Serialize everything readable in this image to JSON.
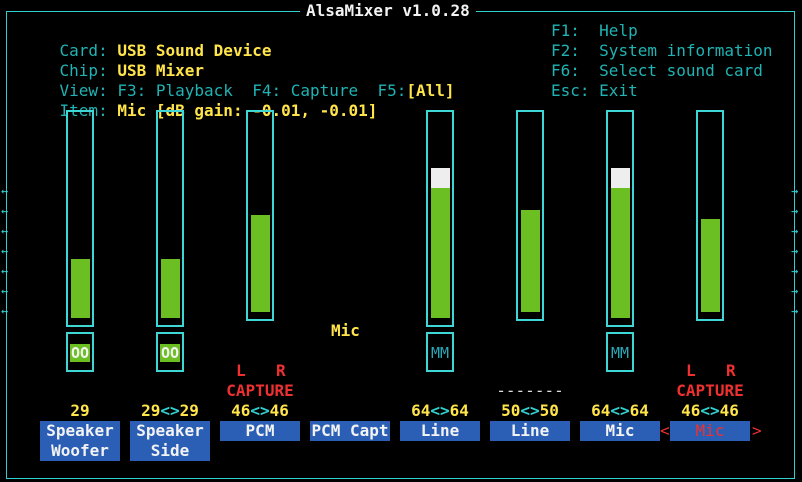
{
  "app": {
    "title": "AlsaMixer v1.0.28"
  },
  "info": {
    "card_label": "Card:",
    "card_value": "USB Sound Device",
    "chip_label": "Chip:",
    "chip_value": "USB Mixer",
    "view_label": "View:",
    "view_playback": "F3: Playback",
    "view_capture": "F4: Capture",
    "view_f5": "F5:",
    "view_all": "[All]",
    "item_label": "Item:",
    "item_value": "Mic [dB gain: -0.01, -0.01]"
  },
  "keys": [
    {
      "key": "F1:",
      "action": "Help"
    },
    {
      "key": "F2:",
      "action": "System information"
    },
    {
      "key": "F6:",
      "action": "Select sound card"
    },
    {
      "key": "Esc:",
      "action": "Exit"
    }
  ],
  "focus_label": "Mic",
  "channels": [
    {
      "name_line1": "Speaker",
      "name_line2": "Woofer",
      "level": 0.29,
      "volume_left": "29",
      "volume_right": "",
      "switch": "OO",
      "capture_l": "",
      "capture_r": "",
      "capture_text": ""
    },
    {
      "name_line1": "Speaker",
      "name_line2": "Side",
      "level": 0.29,
      "volume_left": "29",
      "volume_right": "29",
      "switch": "OO",
      "capture_l": "",
      "capture_r": "",
      "capture_text": ""
    },
    {
      "name_line1": "PCM",
      "name_line2": "",
      "level": 0.48,
      "volume_left": "46",
      "volume_right": "46",
      "switch": "",
      "capture_l": "L",
      "capture_r": "R",
      "capture_text": "CAPTURE"
    },
    {
      "name_line1": "PCM Capt",
      "name_line2": "",
      "level": null,
      "volume_left": "",
      "volume_right": "",
      "switch": "",
      "capture_l": "",
      "capture_r": "",
      "capture_text": ""
    },
    {
      "name_line1": "Line",
      "name_line2": "",
      "level": 0.64,
      "volume_left": "64",
      "volume_right": "64",
      "switch": "MM",
      "capture_l": "",
      "capture_r": "",
      "capture_text": ""
    },
    {
      "name_line1": "Line",
      "name_line2": "",
      "level": 0.5,
      "volume_left": "50",
      "volume_right": "50",
      "switch": "",
      "capture_l": "",
      "capture_r": "",
      "capture_text": "-------"
    },
    {
      "name_line1": "Mic",
      "name_line2": "",
      "level": 0.64,
      "volume_left": "64",
      "volume_right": "64",
      "switch": "MM",
      "capture_l": "",
      "capture_r": "",
      "capture_text": ""
    },
    {
      "name_line1": "Mic",
      "name_line2": "",
      "level": 0.46,
      "volume_left": "46",
      "volume_right": "46",
      "switch": "",
      "capture_l": "L",
      "capture_r": "R",
      "capture_text": "CAPTURE",
      "selected": true
    }
  ],
  "volume_separator": "<>",
  "selection_left": "<",
  "selection_right": ">",
  "scroll_arrow": "←",
  "scroll_arrow_right": "→",
  "colors": {
    "fill": "#6bbf22",
    "peak": "#eeeeee",
    "name_bg": "#2b5fb5",
    "accent": "#ffe44a",
    "capture": "#ee3030",
    "border": "#3fd6d6"
  }
}
